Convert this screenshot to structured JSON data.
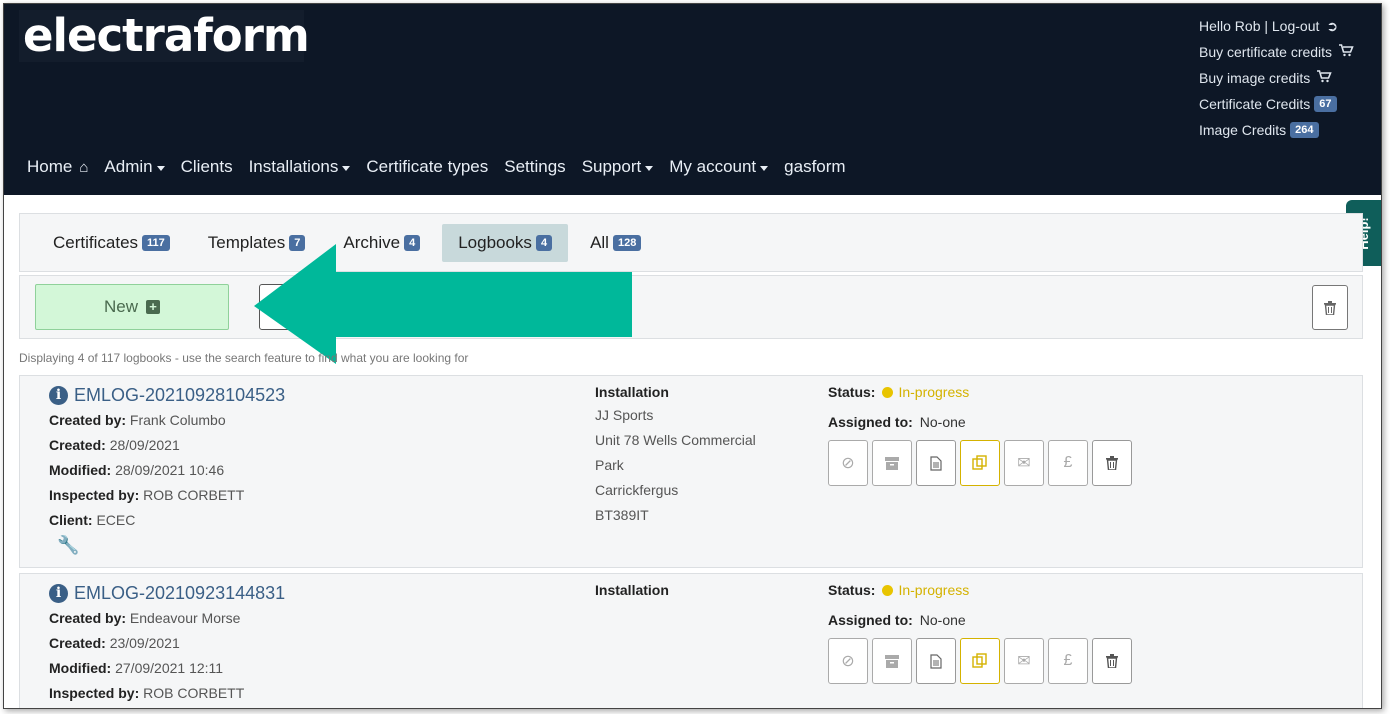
{
  "header": {
    "logo": "electraform",
    "user_menu": {
      "greeting": "Hello Rob | Log-out",
      "buy_certificate": "Buy certificate credits",
      "buy_image": "Buy image credits",
      "certificate_credits_label": "Certificate Credits",
      "certificate_credits_count": "67",
      "image_credits_label": "Image Credits",
      "image_credits_count": "264"
    },
    "nav": {
      "home": "Home",
      "admin": "Admin",
      "clients": "Clients",
      "installations": "Installations",
      "certificate_types": "Certificate types",
      "settings": "Settings",
      "support": "Support",
      "my_account": "My account",
      "gasform": "gasform"
    }
  },
  "help": "Help!",
  "tabs": [
    {
      "label": "Certificates",
      "count": "117"
    },
    {
      "label": "Templates",
      "count": "7"
    },
    {
      "label": "Archive",
      "count": "4"
    },
    {
      "label": "Logbooks",
      "count": "4"
    },
    {
      "label": "All",
      "count": "128"
    }
  ],
  "toolbar": {
    "new_label": "New"
  },
  "caption": "Displaying 4 of 117 logbooks - use the search feature to find what you are looking for",
  "labels": {
    "created_by": "Created by:",
    "created": "Created:",
    "modified": "Modified:",
    "inspected_by": "Inspected by:",
    "client": "Client:",
    "installation": "Installation",
    "status": "Status:",
    "assigned_to": "Assigned to:"
  },
  "records": [
    {
      "id": "EMLOG-20210928104523",
      "created_by": "Frank Columbo",
      "created": "28/09/2021",
      "modified": "28/09/2021 10:46",
      "inspected_by": "ROB CORBETT",
      "client": "ECEC",
      "address": [
        "JJ Sports",
        "Unit 78 Wells Commercial",
        "Park",
        "Carrickfergus",
        "BT389IT"
      ],
      "status": "In-progress",
      "assigned_to": "No-one"
    },
    {
      "id": "EMLOG-20210923144831",
      "created_by": "Endeavour Morse",
      "created": "23/09/2021",
      "modified": "27/09/2021 12:11",
      "inspected_by": "ROB CORBETT",
      "status": "In-progress",
      "assigned_to": "No-one"
    }
  ],
  "colors": {
    "header_bg": "#0d1726",
    "badge": "#4a6fa1",
    "arrow": "#00b89a",
    "status_in_progress": "#e8c400",
    "new_button": "#d3f7d8",
    "help_tab": "#0f5e5a"
  }
}
